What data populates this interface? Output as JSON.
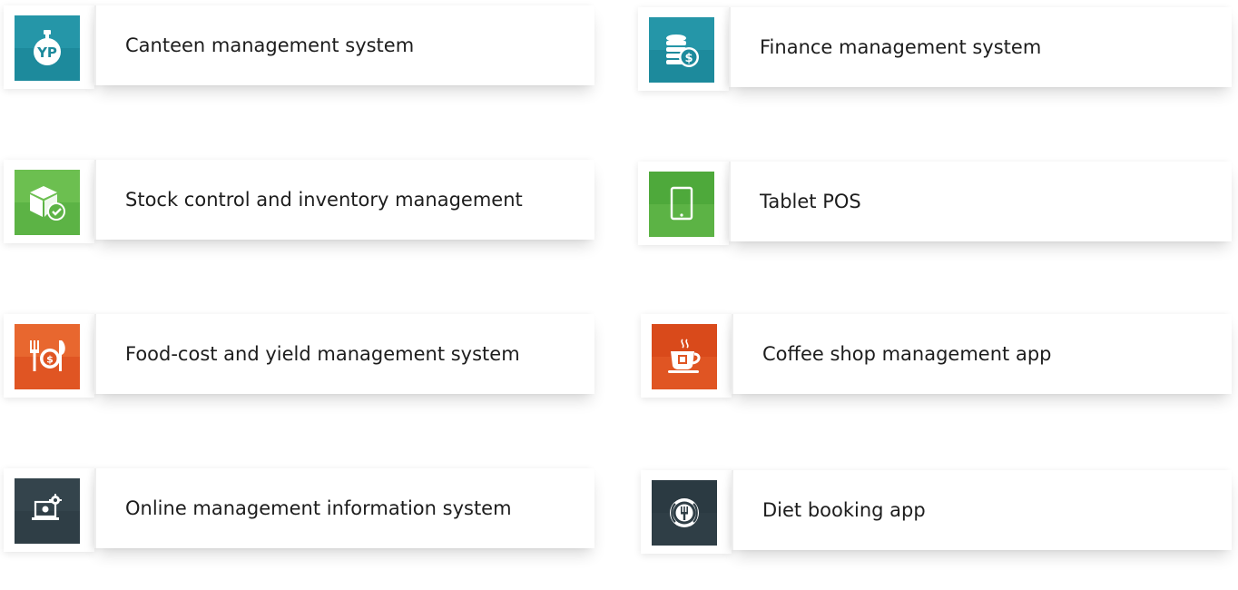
{
  "colors": {
    "teal": "#1d8a9c",
    "green": "#5cb345",
    "orange": "#e05523",
    "slate": "#2f3e46"
  },
  "cards": [
    {
      "label": "Canteen management system",
      "icon": "canteen-scale-icon"
    },
    {
      "label": "Finance management system",
      "icon": "coins-dollar-icon"
    },
    {
      "label": "Stock control and inventory management",
      "icon": "package-check-icon"
    },
    {
      "label": "Tablet POS",
      "icon": "tablet-icon"
    },
    {
      "label": "Food-cost and yield management system",
      "icon": "cutlery-plate-icon"
    },
    {
      "label": "Coffee shop management app",
      "icon": "coffee-cup-icon"
    },
    {
      "label": "Online management information system",
      "icon": "laptop-gear-icon"
    },
    {
      "label": "Diet booking app",
      "icon": "plate-fork-icon"
    }
  ]
}
